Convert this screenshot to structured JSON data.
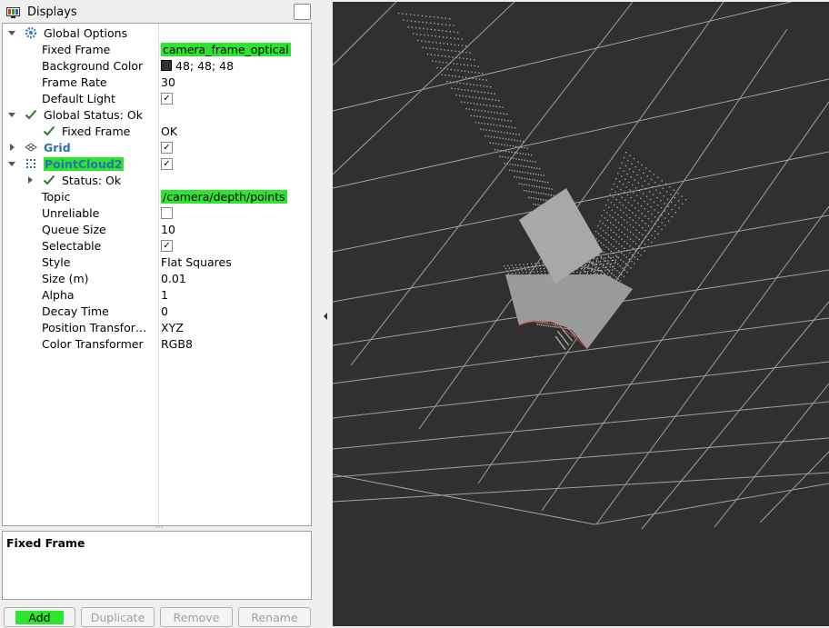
{
  "panel": {
    "title": "Displays",
    "tree": [
      {
        "id": "global-options",
        "label": "Global Options",
        "kind": "group",
        "expanded": true,
        "icon": "gear-icon"
      },
      {
        "id": "fixed-frame",
        "label": "Fixed Frame",
        "value": "camera_frame_optical",
        "highlight": true
      },
      {
        "id": "background-color",
        "label": "Background Color",
        "value": "48; 48; 48",
        "swatch": "#303030"
      },
      {
        "id": "frame-rate",
        "label": "Frame Rate",
        "value": "30"
      },
      {
        "id": "default-light",
        "label": "Default Light",
        "checked": true
      },
      {
        "id": "global-status",
        "label": "Global Status: Ok",
        "kind": "group",
        "expanded": true,
        "icon": "check-icon"
      },
      {
        "id": "status-fixed-frame",
        "label": "Fixed Frame",
        "value": "OK",
        "icon": "check-icon"
      },
      {
        "id": "grid",
        "label": "Grid",
        "kind": "display",
        "expanded": false,
        "icon": "grid-icon",
        "checked": true
      },
      {
        "id": "pointcloud2",
        "label": "PointCloud2",
        "kind": "display",
        "expanded": true,
        "icon": "pointcloud-icon",
        "checked": true,
        "highlight": true
      },
      {
        "id": "status-ok",
        "label": "Status: Ok",
        "kind": "group",
        "expanded": false,
        "icon": "check-icon"
      },
      {
        "id": "topic",
        "label": "Topic",
        "value": "/camera/depth/points",
        "highlight": true
      },
      {
        "id": "unreliable",
        "label": "Unreliable",
        "checked": false
      },
      {
        "id": "queue-size",
        "label": "Queue Size",
        "value": "10"
      },
      {
        "id": "selectable",
        "label": "Selectable",
        "checked": true
      },
      {
        "id": "style",
        "label": "Style",
        "value": "Flat Squares"
      },
      {
        "id": "size",
        "label": "Size (m)",
        "value": "0.01"
      },
      {
        "id": "alpha",
        "label": "Alpha",
        "value": "1"
      },
      {
        "id": "decay-time",
        "label": "Decay Time",
        "value": "0"
      },
      {
        "id": "position-transformer",
        "label": "Position Transfor…",
        "value": "XYZ"
      },
      {
        "id": "color-transformer",
        "label": "Color Transformer",
        "value": "RGB8"
      }
    ],
    "description": {
      "title": "Fixed Frame"
    },
    "buttons": [
      {
        "id": "add",
        "label": "Add",
        "enabled": true,
        "highlight": true
      },
      {
        "id": "duplicate",
        "label": "Duplicate",
        "enabled": false
      },
      {
        "id": "remove",
        "label": "Remove",
        "enabled": false
      },
      {
        "id": "rename",
        "label": "Rename",
        "enabled": false
      }
    ]
  },
  "colors": {
    "highlight": "#2ee52e",
    "viewport_background": "#303030",
    "grid_line": "#a0a0a0",
    "points": "#b4b4b4",
    "display_name_blue": "#2a6fb5"
  }
}
